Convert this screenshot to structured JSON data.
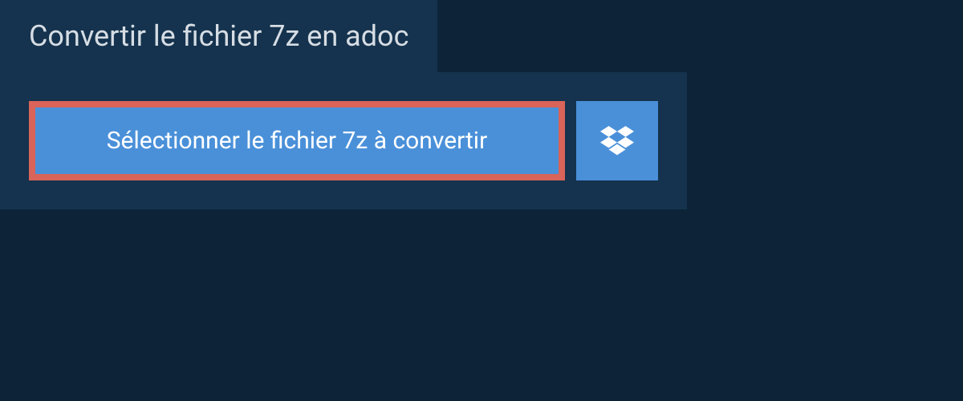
{
  "header": {
    "tab_label": "Convertir le fichier 7z en adoc"
  },
  "actions": {
    "select_file_label": "Sélectionner le fichier 7z à convertir"
  },
  "colors": {
    "background": "#0d2438",
    "panel": "#15334e",
    "button": "#4a90d9",
    "highlight_border": "#d96459",
    "text_light": "#d6dde4",
    "text_white": "#ffffff"
  }
}
